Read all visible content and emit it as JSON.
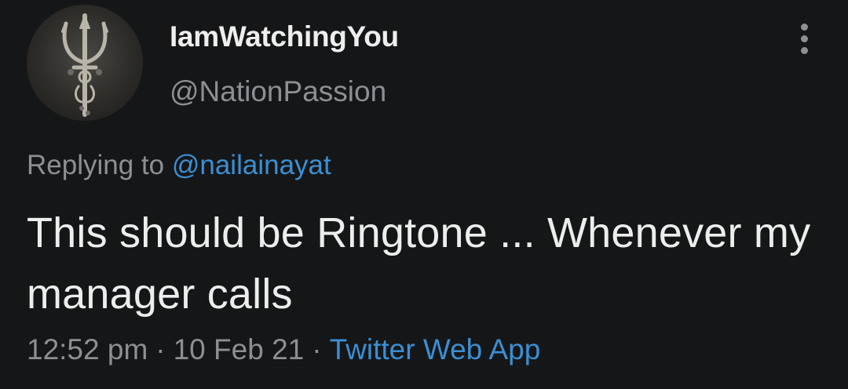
{
  "user": {
    "display_name": "IamWatchingYou",
    "handle": "@NationPassion",
    "avatar": "trishul-avatar"
  },
  "reply": {
    "prefix": "Replying to",
    "mention": "@nailainayat"
  },
  "tweet": {
    "text": "This should be Ringtone ... Whenever my manager calls"
  },
  "meta": {
    "time": "12:52 pm",
    "date": "10 Feb 21",
    "separator": "·",
    "source": "Twitter Web App"
  },
  "icons": {
    "more": "more-vertical-icon"
  },
  "colors": {
    "background": "#151617",
    "link": "#3a8fd3",
    "muted": "#8b9095",
    "text": "#eceded"
  }
}
